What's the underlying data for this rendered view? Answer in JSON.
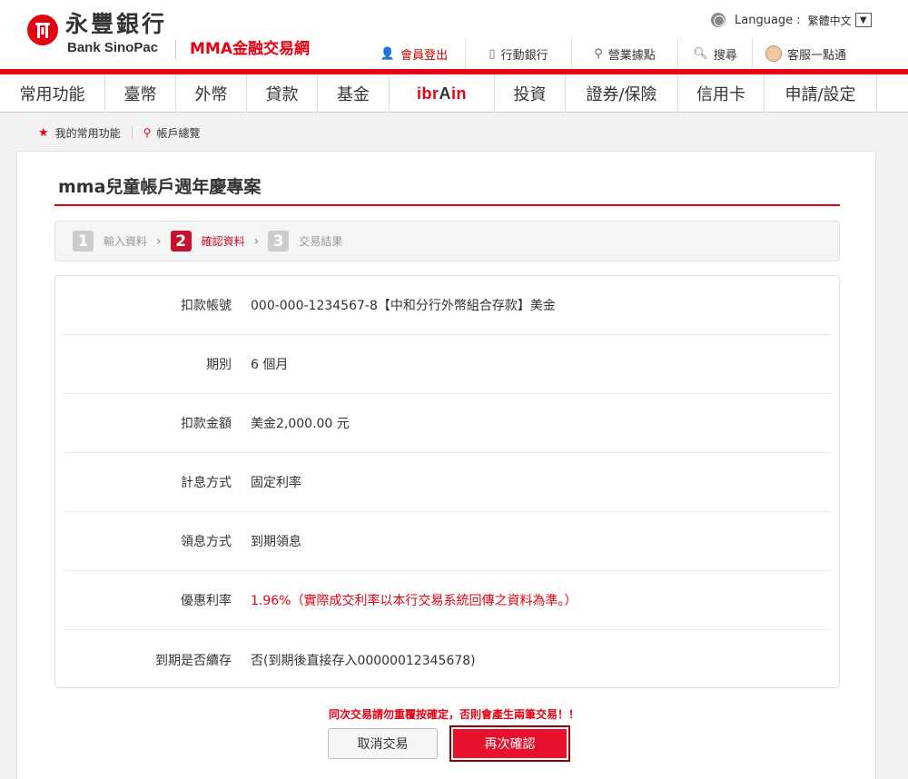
{
  "brand": {
    "name_cn": "永豐銀行",
    "name_en": "Bank SinoPac",
    "site_name": "MMA金融交易網",
    "brand_color": "#e60012"
  },
  "language": {
    "label": "Language :",
    "selected": "繁體中文",
    "icon": "globe-icon"
  },
  "top_links": [
    {
      "label": "會員登出",
      "icon": "person-icon"
    },
    {
      "label": "行動銀行",
      "icon": "phone-icon"
    },
    {
      "label": "營業據點",
      "icon": "location-pin-icon"
    },
    {
      "label": "搜尋",
      "icon": "search-icon"
    },
    {
      "label": "客服一點通",
      "icon": "service-avatar-icon"
    }
  ],
  "nav": [
    "常用功能",
    "臺幣",
    "外幣",
    "貸款",
    "基金",
    "ibrAin",
    "投資",
    "證券/保險",
    "信用卡",
    "申請/設定"
  ],
  "breadcrumb": {
    "favorites": "我的常用功能",
    "overview": "帳戶總覽"
  },
  "page_title": "mma兒童帳戶週年慶專案",
  "steps": [
    {
      "num": "1",
      "label": "輸入資料",
      "active": false
    },
    {
      "num": "2",
      "label": "確認資料",
      "active": true
    },
    {
      "num": "3",
      "label": "交易結果",
      "active": false
    }
  ],
  "details": [
    {
      "label": "扣款帳號",
      "value": "000-000-1234567-8【中和分行外幣組合存款】美金"
    },
    {
      "label": "期別",
      "value": "6 個月"
    },
    {
      "label": "扣款金額",
      "value": "美金2,000.00 元"
    },
    {
      "label": "計息方式",
      "value": "固定利率"
    },
    {
      "label": "領息方式",
      "value": "到期領息"
    },
    {
      "label": "優惠利率",
      "value": "1.96%（實際成交利率以本行交易系統回傳之資料為準。）"
    },
    {
      "label": "到期是否續存",
      "value": "否(到期後直接存入00000012345678)"
    }
  ],
  "warning": "同次交易請勿重覆按確定，否則會產生兩筆交易！！",
  "buttons": {
    "cancel": "取消交易",
    "confirm": "再次確認"
  }
}
